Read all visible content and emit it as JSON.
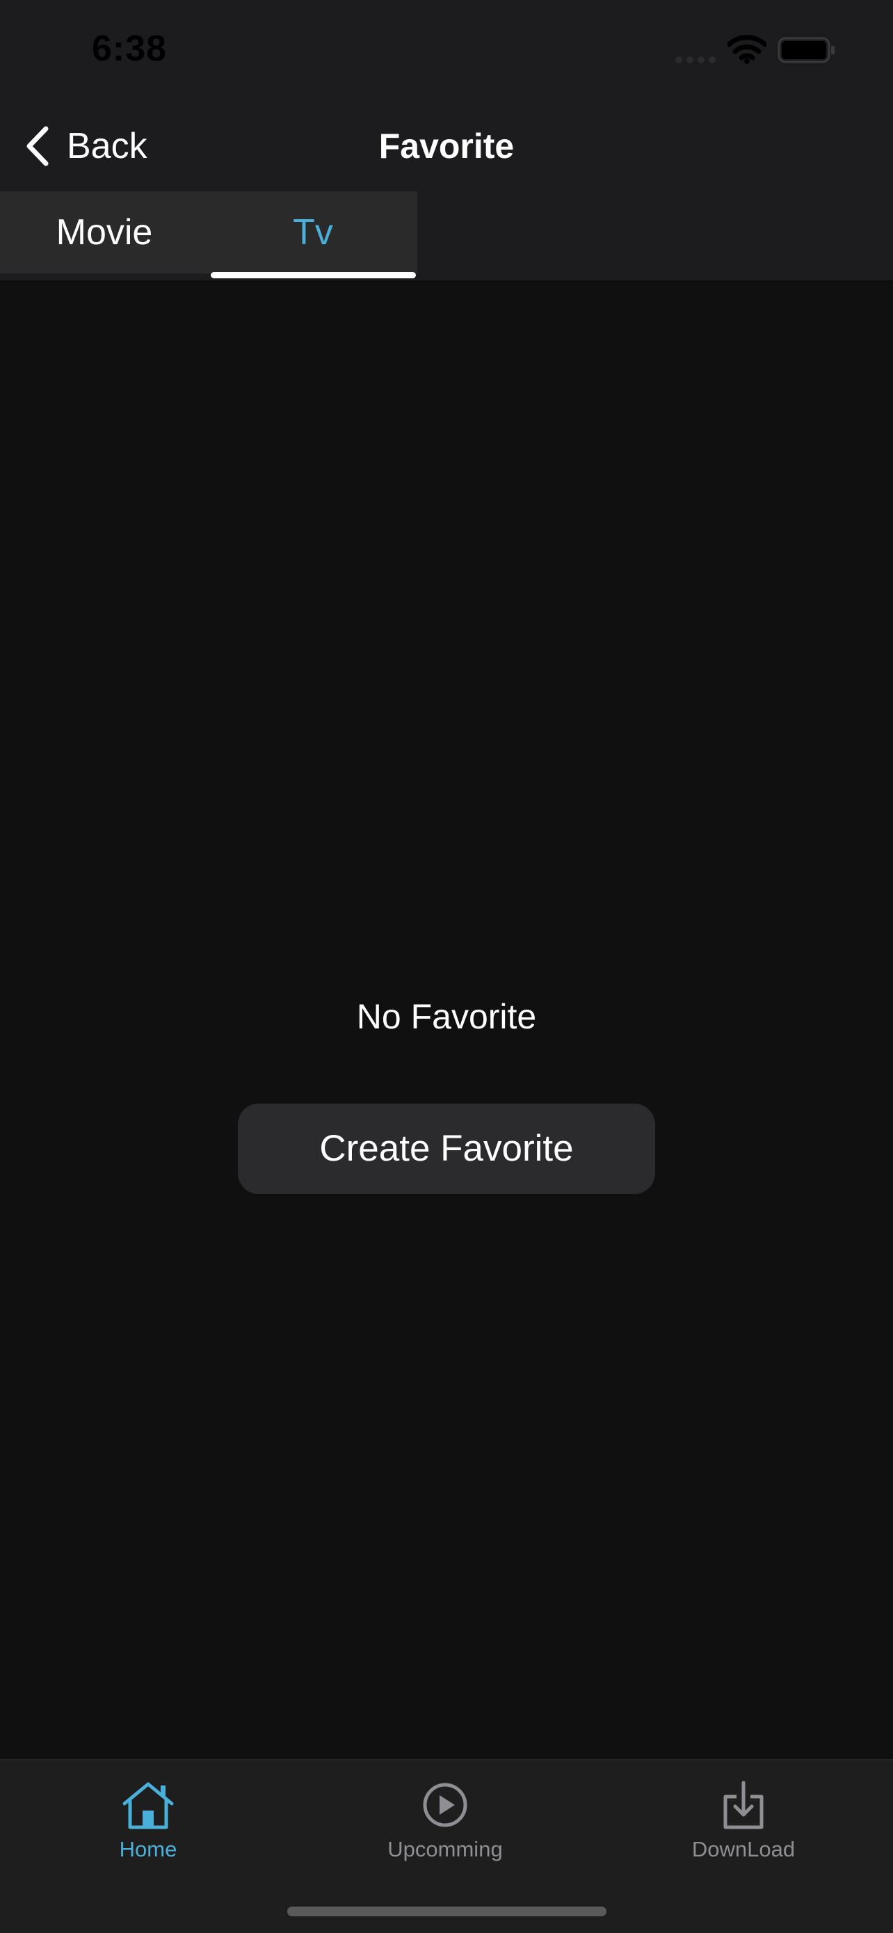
{
  "status_bar": {
    "time": "6:38"
  },
  "nav_bar": {
    "back_label": "Back",
    "title": "Favorite"
  },
  "tabs": [
    {
      "label": "Movie",
      "selected": false
    },
    {
      "label": "Tv",
      "selected": true
    }
  ],
  "content": {
    "empty_message": "No Favorite",
    "create_button_label": "Create Favorite"
  },
  "bottom_nav": {
    "items": [
      {
        "label": "Home",
        "icon": "home-icon",
        "active": true
      },
      {
        "label": "Upcomming",
        "icon": "play-circle-icon",
        "active": false
      },
      {
        "label": "DownLoad",
        "icon": "download-icon",
        "active": false
      }
    ]
  },
  "colors": {
    "accent": "#4ab0d9",
    "background": "#101010",
    "bar_background": "#1c1c1e",
    "inactive": "#8e8e93"
  }
}
